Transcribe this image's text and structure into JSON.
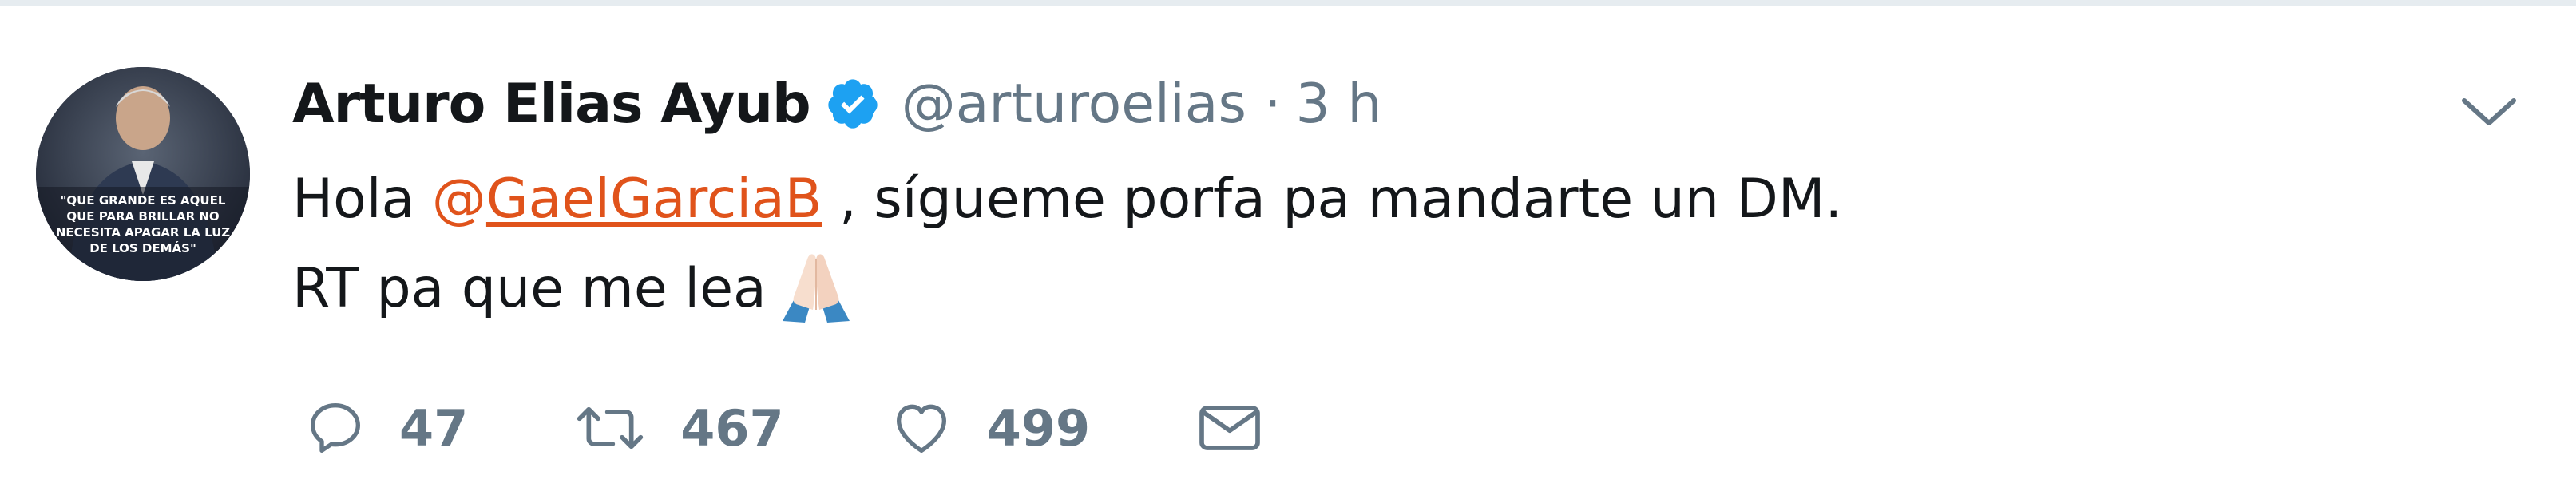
{
  "tweet": {
    "author_name": "Arturo Elias Ayub",
    "handle": "@arturoelias",
    "separator": "·",
    "time": "3 h",
    "text_line1_before": "Hola ",
    "mention_at": "@",
    "mention_name": "GaelGarciaB",
    "text_line1_after": "  , sígueme porfa pa mandarte un DM.",
    "text_line2": "RT pa que me lea",
    "reply_count": "47",
    "retweet_count": "467",
    "like_count": "499",
    "avatar_caption": "\"QUE GRANDE ES AQUEL QUE PARA BRILLAR NO NECESITA APAGAR LA LUZ DE LOS DEMÁS\""
  },
  "icons": {
    "verified": "verified-badge-icon",
    "caret": "chevron-down-icon",
    "reply": "reply-icon",
    "retweet": "retweet-icon",
    "like": "heart-icon",
    "dm": "envelope-icon",
    "emoji": "folded-hands-emoji"
  },
  "colors": {
    "name": "#14171a",
    "meta": "#657786",
    "verified": "#1da1f2",
    "mention": "#e0531b"
  }
}
